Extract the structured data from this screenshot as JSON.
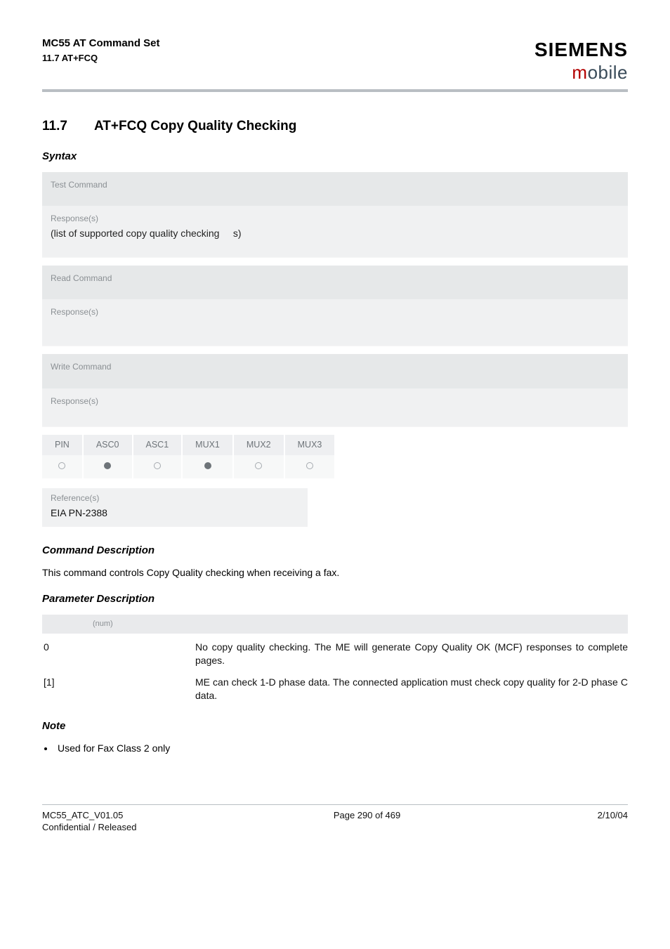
{
  "header": {
    "title": "MC55 AT Command Set",
    "subtitle": "11.7 AT+FCQ",
    "brand_top": "SIEMENS",
    "brand_bottom_m": "m",
    "brand_bottom_rest": "obile"
  },
  "section": {
    "number": "11.7",
    "title": "AT+FCQ   Copy Quality Checking"
  },
  "syntax": {
    "heading": "Syntax",
    "test": {
      "label": "Test Command",
      "response_label": "Response(s)",
      "response_text_a": "(list of supported copy quality checking",
      "response_text_b": "s)"
    },
    "read": {
      "label": "Read Command",
      "response_label": "Response(s)"
    },
    "write": {
      "label": "Write Command",
      "response_label": "Response(s)"
    }
  },
  "pin": {
    "headers": [
      "PIN",
      "ASC0",
      "ASC1",
      "MUX1",
      "MUX2",
      "MUX3"
    ],
    "values": [
      "empty",
      "filled",
      "empty",
      "filled",
      "empty",
      "empty"
    ]
  },
  "reference": {
    "label": "Reference(s)",
    "text": "EIA PN-2388"
  },
  "cmd_desc": {
    "heading": "Command Description",
    "text": "This command controls Copy Quality checking when receiving a fax."
  },
  "param": {
    "heading": "Parameter Description",
    "tag": "(num)",
    "rows": [
      {
        "key": "0",
        "desc": "No copy quality checking. The ME will generate Copy Quality OK (MCF) responses to complete pages."
      },
      {
        "key": "[1]",
        "desc": "ME can check 1-D phase data. The connected application must check copy quality for 2-D phase C data."
      }
    ]
  },
  "note": {
    "heading": "Note",
    "item": "Used for Fax Class 2 only"
  },
  "footer": {
    "left1": "MC55_ATC_V01.05",
    "left2": "Confidential / Released",
    "center": "Page 290 of 469",
    "right": "2/10/04"
  }
}
